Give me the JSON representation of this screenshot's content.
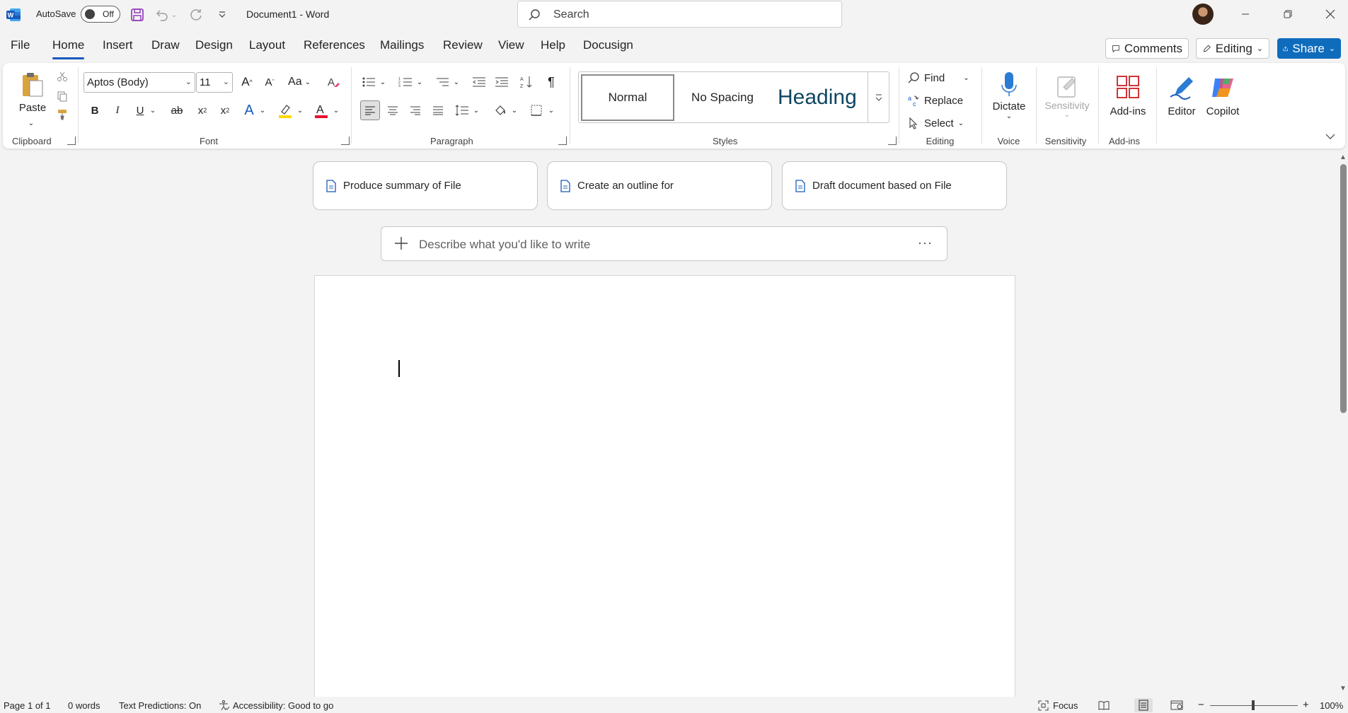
{
  "titlebar": {
    "autosave_label": "AutoSave",
    "autosave_state": "Off",
    "doc_title": "Document1  -  Word",
    "search_placeholder": "Search"
  },
  "menu": {
    "tabs": [
      "File",
      "Home",
      "Insert",
      "Draw",
      "Design",
      "Layout",
      "References",
      "Mailings",
      "Review",
      "View",
      "Help",
      "Docusign"
    ],
    "active_tab": "Home",
    "comments_label": "Comments",
    "editing_label": "Editing",
    "share_label": "Share"
  },
  "ribbon": {
    "clipboard": {
      "paste": "Paste",
      "label": "Clipboard"
    },
    "font": {
      "font_name": "Aptos (Body)",
      "font_size": "11",
      "label": "Font",
      "change_case": "Aa"
    },
    "paragraph": {
      "label": "Paragraph"
    },
    "styles": {
      "normal": "Normal",
      "no_spacing": "No Spacing",
      "heading": "Heading",
      "label": "Styles"
    },
    "editing": {
      "find": "Find",
      "replace": "Replace",
      "select": "Select",
      "label": "Editing"
    },
    "voice": {
      "dictate": "Dictate",
      "label": "Voice"
    },
    "sensitivity": {
      "button": "Sensitivity",
      "label": "Sensitivity"
    },
    "addins": {
      "button": "Add-ins",
      "label": "Add-ins"
    },
    "editor": "Editor",
    "copilot": "Copilot"
  },
  "copilot": {
    "suggestions": [
      "Produce summary of File",
      "Create an outline for",
      "Draft document based on File"
    ],
    "prompt_placeholder": "Describe what you'd like to write",
    "more": "···"
  },
  "statusbar": {
    "page": "Page 1 of 1",
    "words": "0 words",
    "text_predictions": "Text Predictions: On",
    "accessibility": "Accessibility: Good to go",
    "focus": "Focus",
    "zoom": "100%",
    "zoom_minus": "−",
    "zoom_plus": "+"
  },
  "colors": {
    "accent": "#185abd",
    "share": "#0f6cbd",
    "heading_style": "#0f4761",
    "word_logo": "#185abd"
  }
}
